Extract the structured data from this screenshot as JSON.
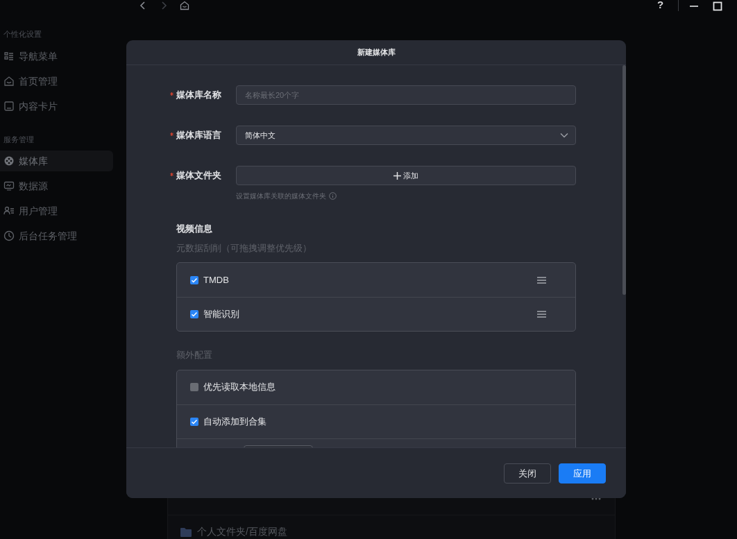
{
  "titlebar": {
    "help": "?"
  },
  "sidebar": {
    "sections": [
      {
        "title": "个性化设置",
        "items": [
          {
            "label": "导航菜单",
            "selected": false
          },
          {
            "label": "首页管理",
            "selected": false
          },
          {
            "label": "内容卡片",
            "selected": false
          }
        ]
      },
      {
        "title": "服务管理",
        "items": [
          {
            "label": "媒体库",
            "selected": true
          },
          {
            "label": "数据源",
            "selected": false
          },
          {
            "label": "用户管理",
            "selected": false
          },
          {
            "label": "后台任务管理",
            "selected": false
          }
        ]
      }
    ]
  },
  "page": {
    "card": {
      "folder": "个人文件夹/百度网盘"
    }
  },
  "dialog": {
    "title": "新建媒体库",
    "fields": [
      {
        "kind": "text",
        "label": "媒体库名称",
        "required": true,
        "placeholder": "名称最长20个字"
      },
      {
        "kind": "select",
        "label": "媒体库语言",
        "required": true,
        "value": "简体中文"
      },
      {
        "kind": "add",
        "label": "媒体文件夹",
        "required": true,
        "button": "添加",
        "hint": "设置媒体库关联的媒体文件夹"
      }
    ],
    "video_info": {
      "title": "视频信息",
      "subtitle": "元数据刮削（可拖拽调整优先级）",
      "scrapers": [
        {
          "label": "TMDB",
          "checked": true
        },
        {
          "label": "智能识别",
          "checked": true
        }
      ]
    },
    "extra": {
      "title": "额外配置",
      "options": [
        {
          "label": "优先读取本地信息",
          "checked": false
        },
        {
          "label": "自动添加到合集",
          "checked": true
        }
      ]
    },
    "buttons": [
      {
        "label": "关闭",
        "kind": "secondary"
      },
      {
        "label": "应用",
        "kind": "primary"
      }
    ]
  }
}
